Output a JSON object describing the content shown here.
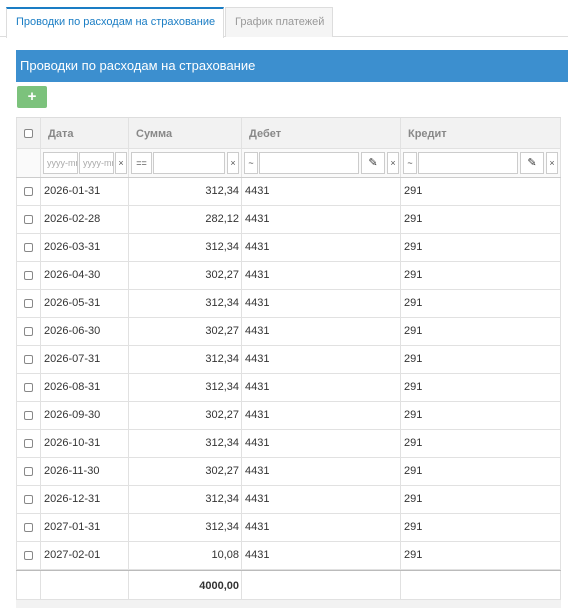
{
  "tabs": [
    {
      "label": "Проводки по расходам на страхование"
    },
    {
      "label": "График платежей"
    }
  ],
  "panel": {
    "title": "Проводки по расходам на страхование",
    "add_label": "+"
  },
  "columns": {
    "date": "Дата",
    "amount": "Сумма",
    "debit": "Дебет",
    "credit": "Кредит"
  },
  "filters": {
    "date_from_placeholder": "yyyy-mm-dd",
    "date_to_placeholder": "yyyy-mm-dd",
    "clear": "×",
    "amount_op": "==",
    "debit_op": "~",
    "credit_op": "~"
  },
  "rows": [
    {
      "date": "2026-01-31",
      "amount": "312,34",
      "debit": "4431",
      "credit": "291"
    },
    {
      "date": "2026-02-28",
      "amount": "282,12",
      "debit": "4431",
      "credit": "291"
    },
    {
      "date": "2026-03-31",
      "amount": "312,34",
      "debit": "4431",
      "credit": "291"
    },
    {
      "date": "2026-04-30",
      "amount": "302,27",
      "debit": "4431",
      "credit": "291"
    },
    {
      "date": "2026-05-31",
      "amount": "312,34",
      "debit": "4431",
      "credit": "291"
    },
    {
      "date": "2026-06-30",
      "amount": "302,27",
      "debit": "4431",
      "credit": "291"
    },
    {
      "date": "2026-07-31",
      "amount": "312,34",
      "debit": "4431",
      "credit": "291"
    },
    {
      "date": "2026-08-31",
      "amount": "312,34",
      "debit": "4431",
      "credit": "291"
    },
    {
      "date": "2026-09-30",
      "amount": "302,27",
      "debit": "4431",
      "credit": "291"
    },
    {
      "date": "2026-10-31",
      "amount": "312,34",
      "debit": "4431",
      "credit": "291"
    },
    {
      "date": "2026-11-30",
      "amount": "302,27",
      "debit": "4431",
      "credit": "291"
    },
    {
      "date": "2026-12-31",
      "amount": "312,34",
      "debit": "4431",
      "credit": "291"
    },
    {
      "date": "2027-01-31",
      "amount": "312,34",
      "debit": "4431",
      "credit": "291"
    },
    {
      "date": "2027-02-01",
      "amount": "10,08",
      "debit": "4431",
      "credit": "291"
    }
  ],
  "total": {
    "amount": "4000,00"
  },
  "icons": {
    "add": "plus-icon",
    "edit": "pencil-icon",
    "clear": "close-icon"
  },
  "colors": {
    "accent": "#3c8fcf",
    "add_button": "#7cc27c",
    "active_tab": "#1a7dc4"
  }
}
